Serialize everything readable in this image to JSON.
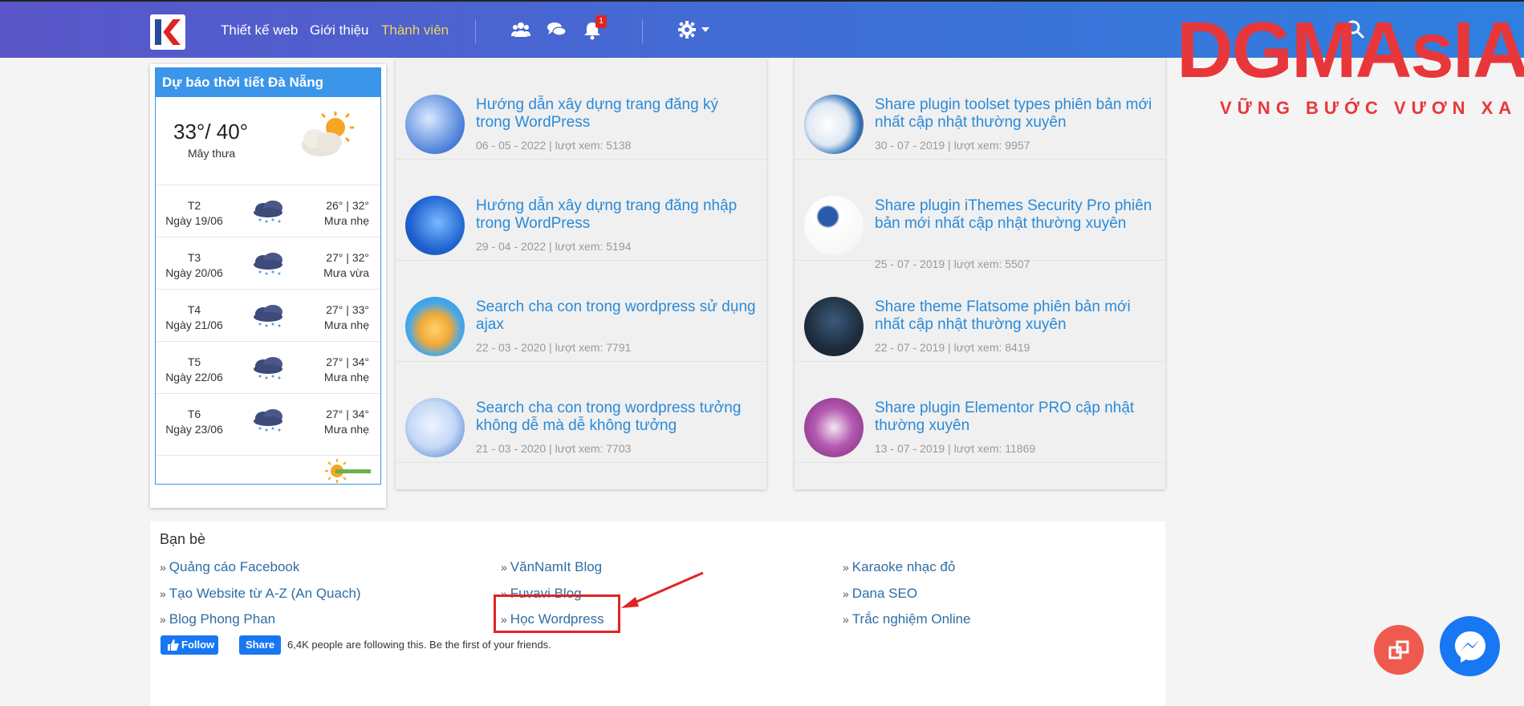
{
  "nav": {
    "items": [
      "Thiết kế web",
      "Giới thiệu",
      "Thành viên"
    ],
    "notification_count": "1"
  },
  "brand": {
    "name": "DGMAsIA",
    "slogan": "VỮNG BƯỚC VƯƠN XA",
    "color": "#e8373a"
  },
  "weather": {
    "title": "Dự báo thời tiết Đà Nẵng",
    "current_temp": "33°/ 40°",
    "current_desc": "Mây thưa",
    "days": [
      {
        "day": "T2",
        "date": "Ngày 19/06",
        "temp": "26° | 32°",
        "desc": "Mưa nhẹ"
      },
      {
        "day": "T3",
        "date": "Ngày 20/06",
        "temp": "27° | 32°",
        "desc": "Mưa vừa"
      },
      {
        "day": "T4",
        "date": "Ngày 21/06",
        "temp": "27° | 33°",
        "desc": "Mưa nhẹ"
      },
      {
        "day": "T5",
        "date": "Ngày 22/06",
        "temp": "27° | 34°",
        "desc": "Mưa nhẹ"
      },
      {
        "day": "T6",
        "date": "Ngày 23/06",
        "temp": "27° | 34°",
        "desc": "Mưa nhẹ"
      }
    ]
  },
  "posts_left": [
    {
      "title": "Hướng dẫn xây dựng trang đăng ký trong WordPress",
      "meta": "06 - 05 - 2022 | lượt xem: 5138"
    },
    {
      "title": "Hướng dẫn xây dựng trang đăng nhập trong WordPress",
      "meta": "29 - 04 - 2022 | lượt xem: 5194"
    },
    {
      "title": "Search cha con trong wordpress sử dụng ajax",
      "meta": "22 - 03 - 2020 | lượt xem: 7791"
    },
    {
      "title": "Search cha con trong wordpress tưởng không dễ mà dễ không tưởng",
      "meta": "21 - 03 - 2020 | lượt xem: 7703"
    }
  ],
  "posts_right": [
    {
      "title": "Share plugin toolset types phiên bản mới nhất cập nhật thường xuyên",
      "meta": "30 - 07 - 2019 | lượt xem: 9957"
    },
    {
      "title": "Share plugin iThemes Security Pro phiên bản mới nhất cập nhật thường xuyên",
      "meta": "25 - 07 - 2019 | lượt xem: 5507"
    },
    {
      "title": "Share theme Flatsome phiên bản mới nhất cập nhật thường xuyên",
      "meta": "22 - 07 - 2019 | lượt xem: 8419"
    },
    {
      "title": "Share plugin Elementor PRO cập nhật thường xuyên",
      "meta": "13 - 07 - 2019 | lượt xem: 11869"
    }
  ],
  "friends": {
    "title": "Bạn bè",
    "col1": [
      "Quảng cáo Facebook",
      "Tạo Website từ A-Z (An Quach)",
      "Blog Phong Phan"
    ],
    "col2": [
      "VănNamIt Blog",
      "Fuvavi Blog",
      "Học Wordpress"
    ],
    "col3": [
      "Karaoke nhạc đỏ",
      "Dana SEO",
      "Trắc nghiệm Online"
    ]
  },
  "facebook": {
    "follow_label": "Follow",
    "share_label": "Share",
    "followers_text": "6,4K people are following this. Be the first of your friends."
  }
}
